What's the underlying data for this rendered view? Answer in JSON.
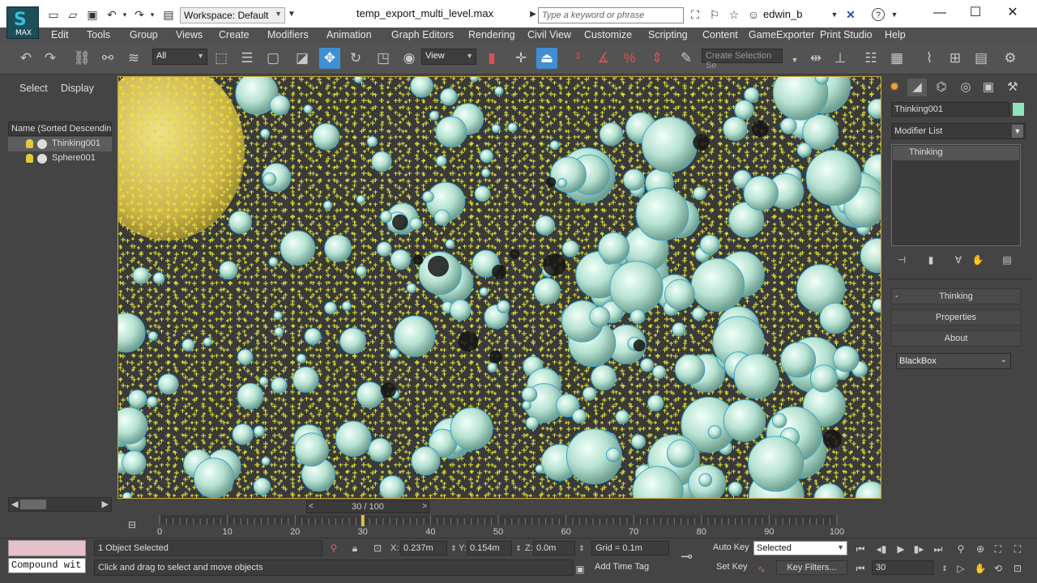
{
  "titlebar": {
    "workspace": "Workspace: Default",
    "file_name": "temp_export_multi_level.max",
    "search_placeholder": "Type a keyword or phrase",
    "user": "edwin_b",
    "logo_text": "MAX"
  },
  "menu": [
    "Edit",
    "Tools",
    "Group",
    "Views",
    "Create",
    "Modifiers",
    "Animation",
    "Graph Editors",
    "Rendering",
    "Civil View",
    "Customize",
    "Scripting",
    "Content",
    "GameExporter",
    "Print Studio",
    "Help"
  ],
  "toolbar": {
    "selection_filter": "All",
    "reference_coord": "View",
    "selection_set_placeholder": "Create Selection Se"
  },
  "scene_explorer": {
    "tabs": [
      "Select",
      "Display"
    ],
    "column_header": "Name (Sorted Descending)",
    "objects": [
      {
        "name": "Thinking001",
        "selected": true
      },
      {
        "name": "Sphere001",
        "selected": false
      }
    ]
  },
  "command_panel": {
    "object_name": "Thinking001",
    "object_color": "#8fe3bd",
    "modifier_list_label": "Modifier List",
    "stack_entry": "Thinking",
    "rollouts": [
      "Thinking",
      "Properties",
      "About"
    ],
    "rollout_minus": "-",
    "blackbox_option": "BlackBox"
  },
  "timeline": {
    "slider_label": "30 / 100",
    "ticks": [
      "0",
      "10",
      "20",
      "30",
      "40",
      "50",
      "60",
      "70",
      "80",
      "90",
      "100"
    ],
    "current_frame": 30,
    "total_frames": 100
  },
  "status": {
    "maxscript_text": "Compound wit",
    "selection_info": "1 Object Selected",
    "prompt": "Click and drag to select and move objects",
    "x_label": "X:",
    "x_value": "0.237m",
    "y_label": "Y:",
    "y_value": "0.154m",
    "z_label": "Z:",
    "z_value": "0.0m",
    "grid": "Grid = 0.1m",
    "add_time_tag": "Add Time Tag",
    "auto_key": "Auto Key",
    "set_key": "Set Key",
    "selected_set": "Selected",
    "key_filters": "Key Filters...",
    "frame_value": "30"
  },
  "colors": {
    "accent": "#3f8fd2",
    "viewport_border": "#c9a43b",
    "particle": "#e8ec3c",
    "sphere": "#bfe8d8",
    "big_sphere": "#d8c35a"
  }
}
